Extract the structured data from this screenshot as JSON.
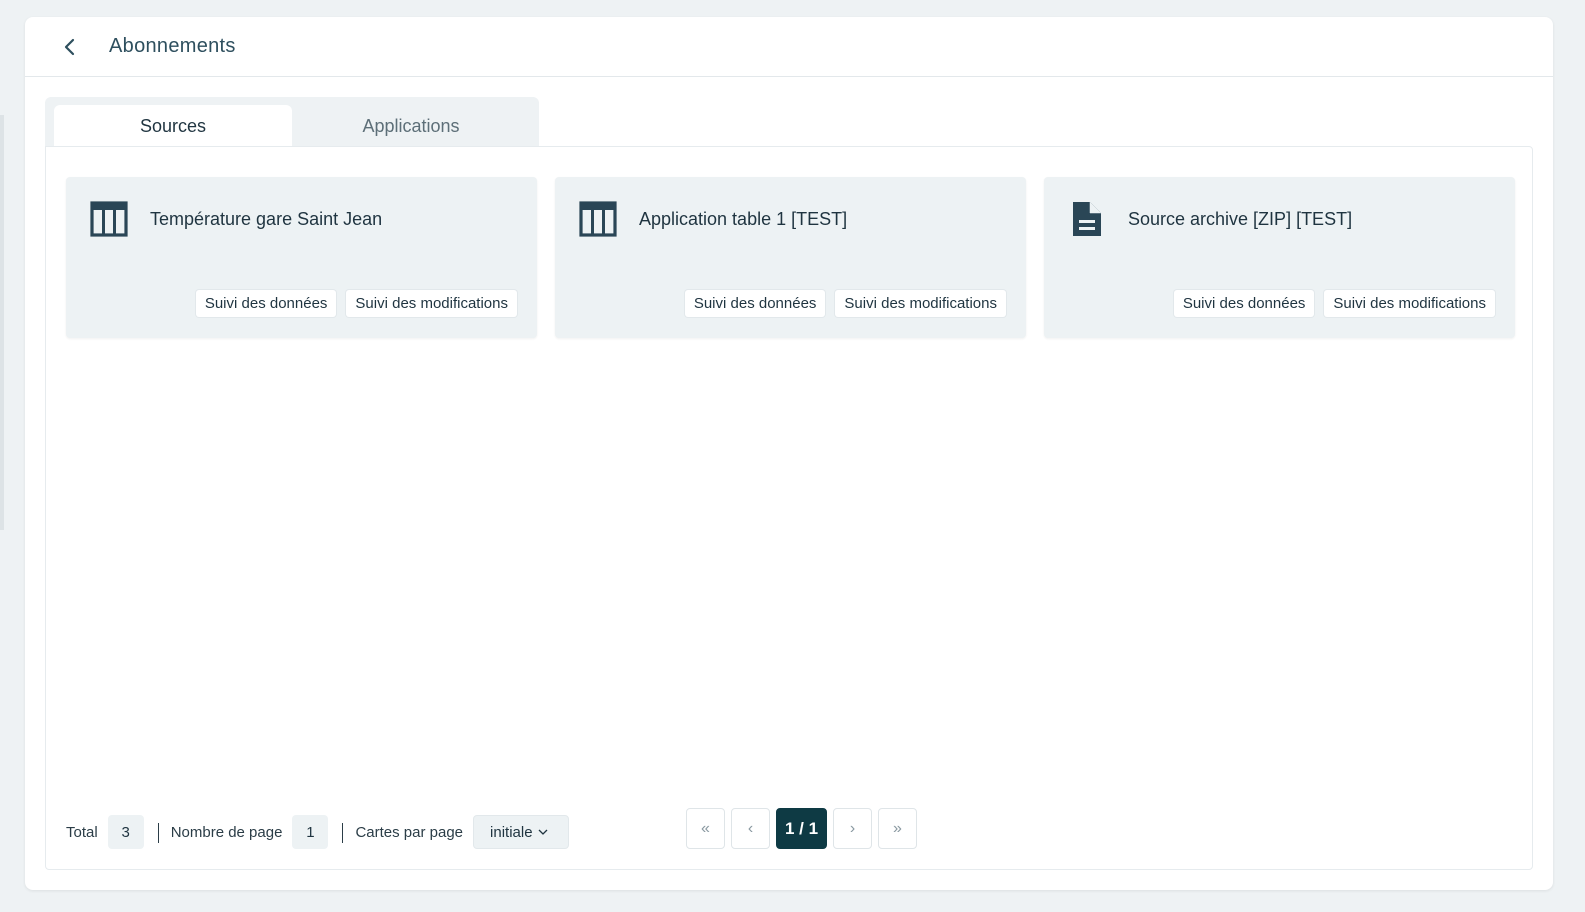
{
  "header": {
    "title": "Abonnements",
    "back_icon": "chevron-left-icon"
  },
  "tabs": [
    {
      "label": "Sources",
      "active": true
    },
    {
      "label": "Applications",
      "active": false
    }
  ],
  "cards": [
    {
      "title": "Température gare Saint Jean",
      "icon": "table-icon",
      "actions": [
        "Suivi des données",
        "Suivi des modifications"
      ]
    },
    {
      "title": "Application table 1 [TEST]",
      "icon": "table-icon",
      "actions": [
        "Suivi des données",
        "Suivi des modifications"
      ]
    },
    {
      "title": "Source archive [ZIP] [TEST]",
      "icon": "document-icon",
      "actions": [
        "Suivi des données",
        "Suivi des modifications"
      ]
    }
  ],
  "footer": {
    "total_label": "Total",
    "total_value": "3",
    "pages_label": "Nombre de page",
    "pages_value": "1",
    "per_page_label": "Cartes par page",
    "per_page_value": "initiale"
  },
  "pagination": {
    "first": "«",
    "prev": "‹",
    "current": "1 / 1",
    "next": "›",
    "last": "»"
  },
  "colors": {
    "accent": "#0e3a44",
    "card_bg": "#edf2f4",
    "icon": "#2a4656"
  }
}
